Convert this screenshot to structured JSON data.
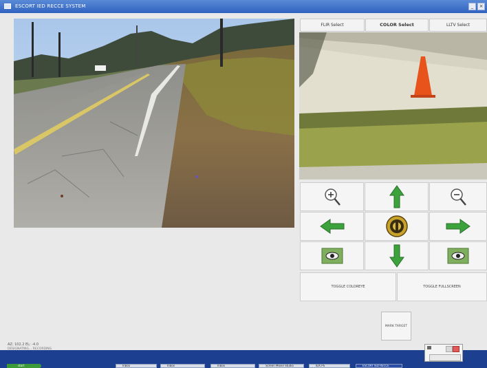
{
  "window": {
    "title": "ESCORT IED RECCE SYSTEM"
  },
  "camera_select": {
    "buttons": [
      {
        "label": "FLIR Select",
        "active": false
      },
      {
        "label": "COLOR Select",
        "active": true
      },
      {
        "label": "LLTV Select",
        "active": false
      }
    ]
  },
  "controls": {
    "zoom_in": "zoom-in",
    "up": "arrow-up",
    "zoom_out": "zoom-out",
    "left": "arrow-left",
    "center": "center-seal",
    "right": "arrow-right",
    "eye_left": "eye",
    "down": "arrow-down",
    "eye_right": "eye",
    "toggle_coloreye": "TOGGLE COLOREYE",
    "toggle_fullscreen": "TOGGLE FULLSCREEN",
    "mark_target": "MARK TARGET"
  },
  "status": {
    "line1": "AZ: 102.2 EL: -4.0",
    "line2": "DESIGNATING... RECORDING"
  },
  "colors": {
    "arrow_green": "#3ca23c",
    "title_blue": "#2f62c0",
    "cone_orange": "#e8521b"
  },
  "taskbar": {
    "start": "start",
    "items": [
      {
        "label": "Inbox"
      },
      {
        "label": "Inbox"
      },
      {
        "label": "Inbox"
      },
      {
        "label": "Screen Movie Studio"
      },
      {
        "label": "IDX.PS"
      },
      {
        "label": "ESCORT IED RECCE"
      }
    ]
  }
}
